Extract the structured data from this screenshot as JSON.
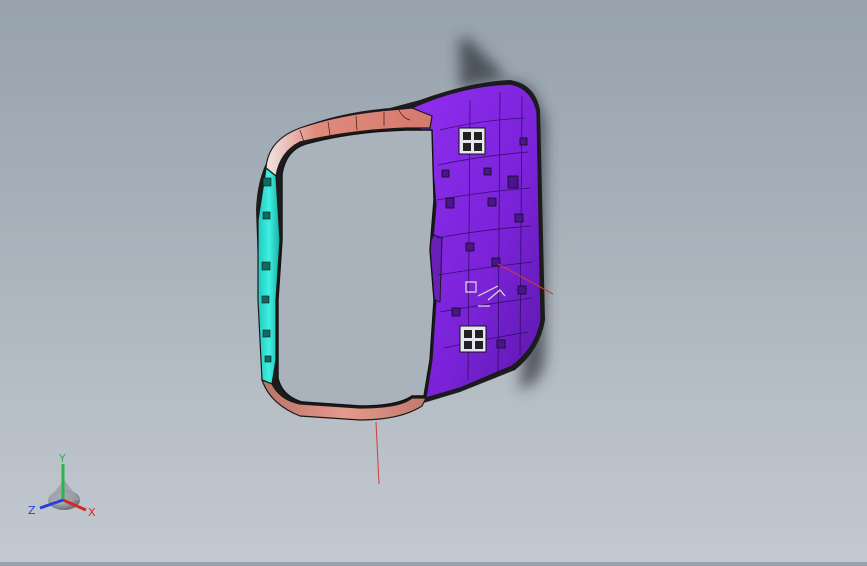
{
  "viewport": {
    "background_top": "#97a2ad",
    "background_bottom": "#c3c9d0",
    "model_colors": {
      "left_rail": "#2fe0d4",
      "top_rim": "#e79a8a",
      "bottom_rim": "#c9867b",
      "right_panel": "#8a2be0",
      "right_panel_dark": "#6a1fb8",
      "edges": "#1b1b1b",
      "shadow": "#3a3f46"
    },
    "annotation_line_color": "#d23a3a"
  },
  "triad": {
    "x_label": "X",
    "y_label": "Y",
    "z_label": "Z",
    "x_color": "#d8262a",
    "y_color": "#2fb34a",
    "z_color": "#2a3fd8"
  }
}
